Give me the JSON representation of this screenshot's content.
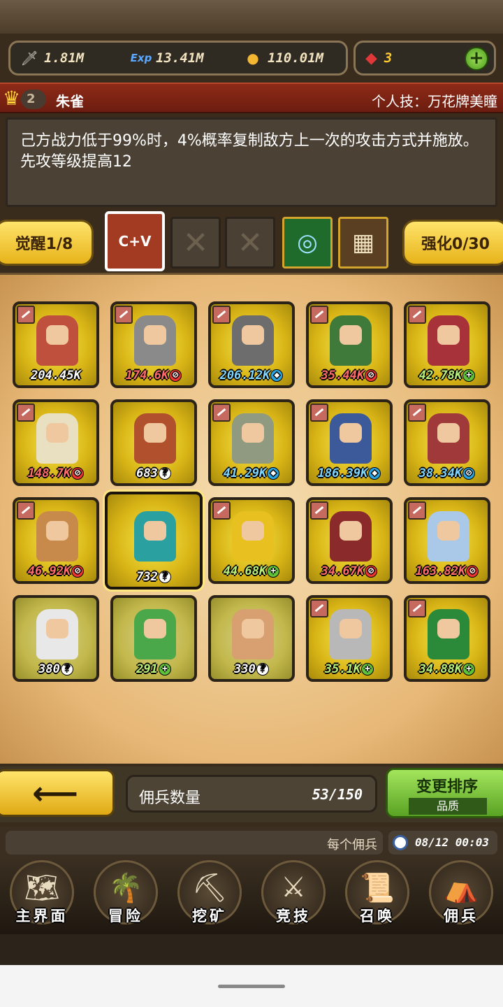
{
  "resources": {
    "attack": "1.81M",
    "exp": "13.41M",
    "gold": "110.01M",
    "gems": "3"
  },
  "hero": {
    "rank": "2",
    "name": "朱雀",
    "skill": "个人技：万花牌美瞳",
    "description": "己方战力低于99%时，4%概率复制敌方上一次的攻击方式并施放。先攻等级提高12"
  },
  "equip": {
    "awaken_label": "觉醒1/8",
    "enhance_label": "强化0/30",
    "active_slot_text": "C+V"
  },
  "cards": [
    {
      "value": "204.45K",
      "badge": "",
      "type": "white"
    },
    {
      "value": "174.6K",
      "badge": "⊘",
      "type": "red"
    },
    {
      "value": "206.12K",
      "badge": "◆",
      "type": "blue"
    },
    {
      "value": "35.44K",
      "badge": "⊘",
      "type": "red"
    },
    {
      "value": "42.78K",
      "badge": "+",
      "type": "green"
    },
    {
      "value": "148.7K",
      "badge": "⊘",
      "type": "red"
    },
    {
      "value": "683",
      "badge": "?",
      "type": "white"
    },
    {
      "value": "41.29K",
      "badge": "◆",
      "type": "blue"
    },
    {
      "value": "186.39K",
      "badge": "◆",
      "type": "blue"
    },
    {
      "value": "38.34K",
      "badge": "⊘",
      "type": "blue"
    },
    {
      "value": "46.92K",
      "badge": "⊘",
      "type": "red"
    },
    {
      "value": "732",
      "badge": "?",
      "type": "white"
    },
    {
      "value": "44.68K",
      "badge": "+",
      "type": "green"
    },
    {
      "value": "34.67K",
      "badge": "⊘",
      "type": "red"
    },
    {
      "value": "163.82K",
      "badge": "⊘",
      "type": "red"
    },
    {
      "value": "380",
      "badge": "?",
      "type": "white"
    },
    {
      "value": "291",
      "badge": "+",
      "type": "green"
    },
    {
      "value": "330",
      "badge": "?",
      "type": "white"
    },
    {
      "value": "35.1K",
      "badge": "+",
      "type": "green"
    },
    {
      "value": "34.88K",
      "badge": "+",
      "type": "green"
    }
  ],
  "controls": {
    "back_icon": "arrow-left-icon",
    "count_label": "佣兵数量",
    "count_value": "53/150",
    "sort_label": "变更排序",
    "sort_sub": "品质"
  },
  "info": {
    "notice": "每个佣兵",
    "time": "08/12 00:03"
  },
  "nav": [
    {
      "label": "主界面",
      "icon": "map-icon"
    },
    {
      "label": "冒险",
      "icon": "island-icon"
    },
    {
      "label": "挖矿",
      "icon": "pickaxe-icon"
    },
    {
      "label": "竞技",
      "icon": "swords-icon"
    },
    {
      "label": "召唤",
      "icon": "scroll-icon"
    },
    {
      "label": "佣兵",
      "icon": "tent-icon"
    }
  ]
}
